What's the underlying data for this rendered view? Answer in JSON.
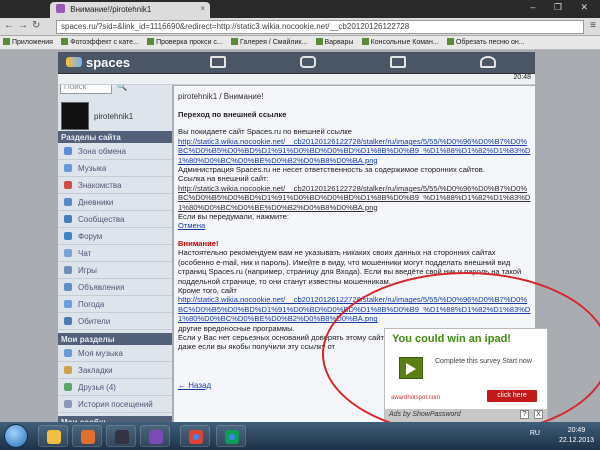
{
  "browser": {
    "tab_title": "Внимание!/pirotehnik1",
    "url": "spaces.ru/?sid=&link_id=1116690&redirect=http://static3.wikia.nocookie.net/__cb20120126122728",
    "bookmarks": [
      "Приложения",
      "Фотоэффект с кате...",
      "Проверка прокси с...",
      "Галерея / Смайлик...",
      "Варвары",
      "Консольные Коман...",
      "Обрезать песню он..."
    ]
  },
  "site": {
    "logo": "spaces",
    "time": "20:48"
  },
  "sidebar": {
    "search_placeholder": "Поиск",
    "username": "pirotehnik1",
    "section1": "Разделы сайта",
    "items": [
      "Зона обмена",
      "Музыка",
      "Знакомства",
      "Дневники",
      "Сообщества",
      "Форум",
      "Чат",
      "Игры",
      "Объявления",
      "Погода",
      "Обители"
    ],
    "section2": "Мои разделы",
    "my_items": [
      "Моя музыка",
      "Закладки",
      "Друзья (4)",
      "История посещений"
    ],
    "section3": "Мои сообщ..."
  },
  "main": {
    "breadcrumb": "pirotehnik1 / Внимание!",
    "heading": "Переход по внешней ссылке",
    "p1": "Вы покидаете сайт Spaces.ru по внешней ссылке",
    "link_url": "http://static3.wikia.nocookie.net/__cb20120126122728/stalker/ru/images/5/55/%D0%96%D0%B7%D0%BC%D0%B5%D0%BD%D1%91%D0%BD%D0%BD%D1%8B%D0%B9_%D1%88%D1%82%D1%83%D1%80%D0%BC%D0%BE%D0%B2%D0%B8%D0%BA.png",
    "p2": "Администрация Spaces.ru не несет ответственность за содержимое сторонних сайтов.",
    "p3": "Ссылка на внешний сайт:",
    "p4": "Если вы передумали, нажмите:",
    "cancel": "Отмена",
    "warn_title": "Внимание!",
    "warn_text": "Настоятельно рекомендуем вам не указывать никаких своих данных на сторонних сайтах (особенно e-mail, ник и пароль). Имейте в виду, что мошенники могут подделать внешний вид страниц Spaces.ru (например, страницу для Входа). Если вы введёте свой ник и пароль на такой поддельной странице, то они станут известны мошенникам.",
    "also": "Кроме того, сайт",
    "other": "другие вредоносные программы.",
    "final": "Если у Вас нет серьезных оснований доверять этому сайту, то мы рекомендуем не переходить, даже если вы якобы получили эту ссылку от",
    "back": "← Назад"
  },
  "ad": {
    "title": "You could win an ipad!",
    "text": "Complete this survey Start now",
    "site": "awardhotspot.com",
    "button": "click here",
    "footer": "Ads by ShowPassword",
    "q": "?",
    "x": "X"
  },
  "taskbar": {
    "lang": "RU",
    "time": "20:49",
    "date": "22.12.2013"
  }
}
